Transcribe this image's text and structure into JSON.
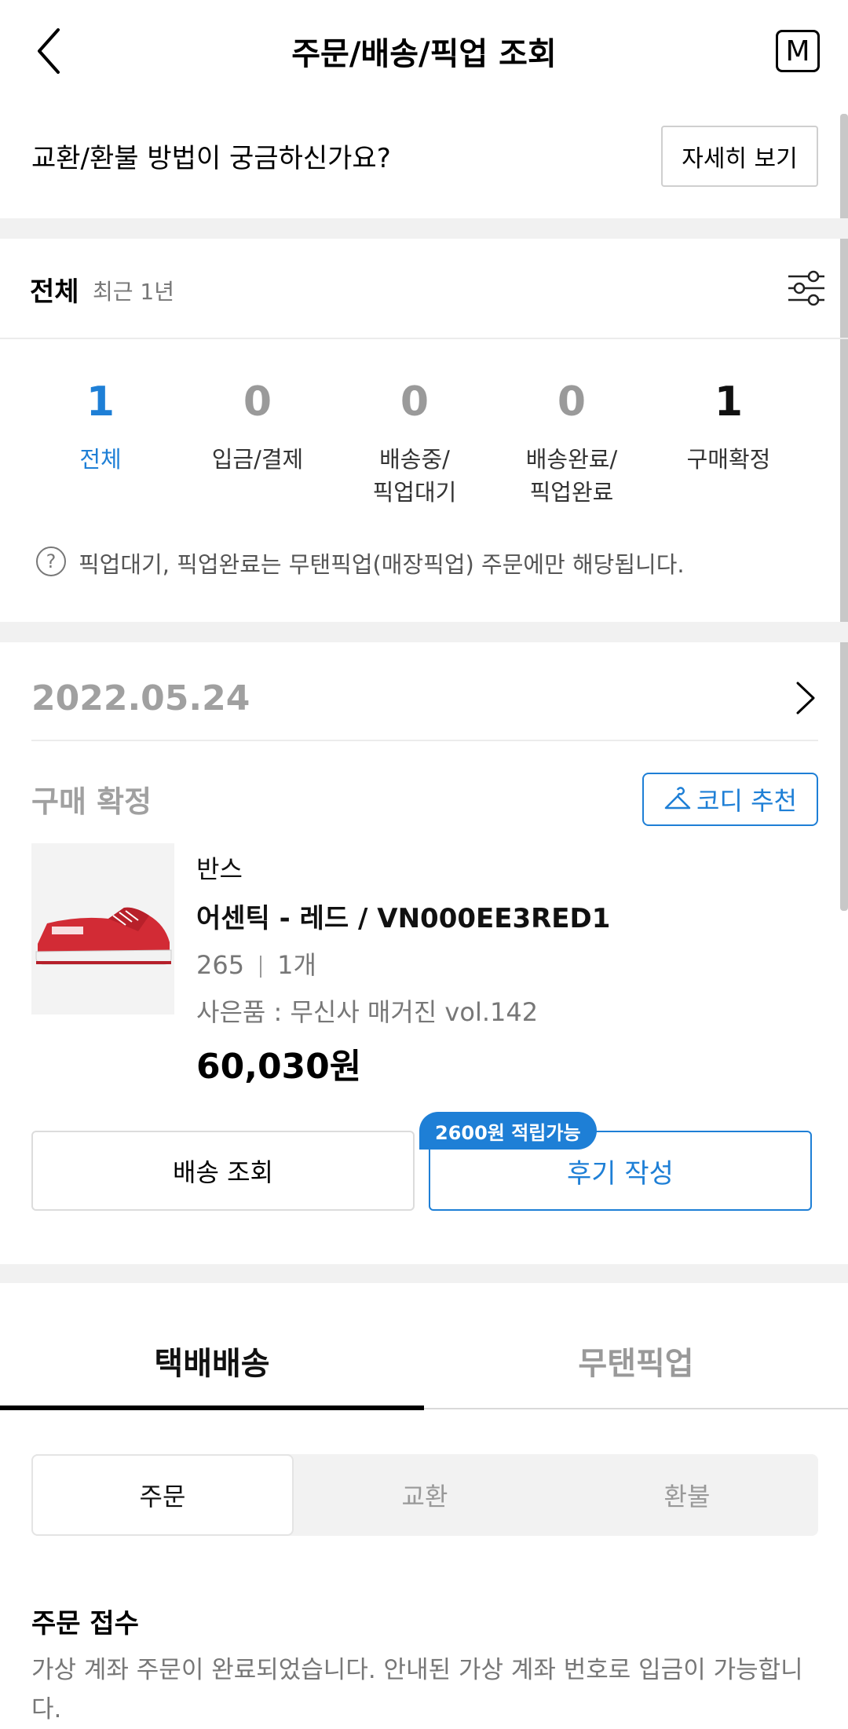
{
  "header": {
    "title": "주문/배송/픽업 조회",
    "menu_label": "M"
  },
  "exchange_info": {
    "text": "교환/환불 방법이 궁금하신가요?",
    "button": "자세히 보기"
  },
  "filter": {
    "label": "전체",
    "period": "최근 1년"
  },
  "status_summary": [
    {
      "count": "1",
      "label_line1": "전체",
      "label_line2": ""
    },
    {
      "count": "0",
      "label_line1": "입금/결제",
      "label_line2": ""
    },
    {
      "count": "0",
      "label_line1": "배송중/",
      "label_line2": "픽업대기"
    },
    {
      "count": "0",
      "label_line1": "배송완료/",
      "label_line2": "픽업완료"
    },
    {
      "count": "1",
      "label_line1": "구매확정",
      "label_line2": ""
    }
  ],
  "notice": "픽업대기, 픽업완료는 무탠픽업(매장픽업) 주문에만 해당됩니다.",
  "order": {
    "date": "2022.05.24",
    "status": "구매 확정",
    "codi_button": "코디 추천",
    "brand": "반스",
    "product_name": "어센틱 - 레드 / VN000EE3RED1",
    "size": "265",
    "quantity": "1개",
    "gift": "사은품 : 무신사 매거진 vol.142",
    "price": "60,030원",
    "delivery_button": "배송 조회",
    "review_button": "후기 작성",
    "points_badge": "2600원 적립가능"
  },
  "tabs": {
    "delivery": "택배배송",
    "pickup": "무탠픽업"
  },
  "segments": {
    "order": "주문",
    "exchange": "교환",
    "refund": "환불"
  },
  "order_info": {
    "title": "주문 접수",
    "description": "가상 계좌 주문이 완료되었습니다. 안내된 가상 계좌 번호로 입금이 가능합니다."
  },
  "colors": {
    "accent": "#1e7fd6",
    "gray_text": "#a0a0a0",
    "band": "#f1f1f1"
  }
}
